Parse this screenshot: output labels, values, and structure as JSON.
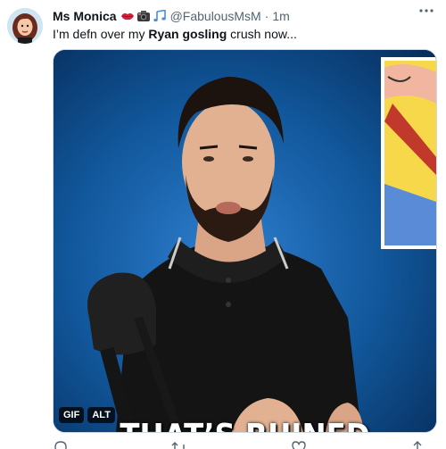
{
  "author": {
    "name": "Ms Monica",
    "handle": "@FabulousMsM",
    "separator": "·",
    "time": "1m",
    "emoji_icons": [
      "lips-icon",
      "camera-icon",
      "music-notes-icon"
    ]
  },
  "tweet": {
    "text_before": "I’m defn over my ",
    "text_bold": "Ryan gosling",
    "text_after": " crush now..."
  },
  "media": {
    "caption": "THAT’S RUINED",
    "gif_badge": "GIF",
    "alt_badge": "ALT",
    "background_color": "#0d4f8f"
  },
  "actions": [
    "reply-icon",
    "retweet-icon",
    "like-icon",
    "share-icon"
  ],
  "more_icon": "more-dots-icon"
}
